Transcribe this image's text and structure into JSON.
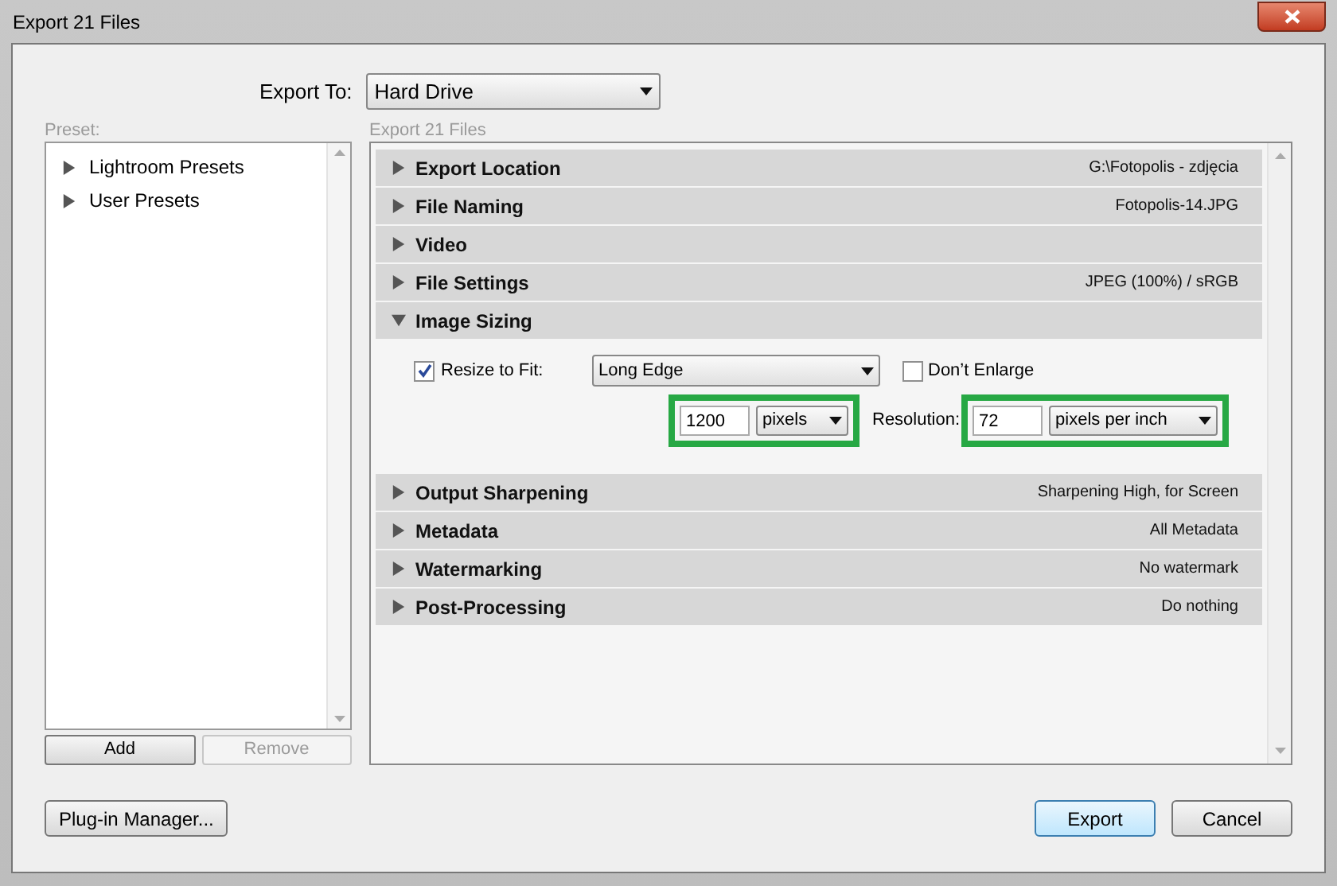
{
  "window": {
    "title": "Export 21 Files"
  },
  "export_to": {
    "label": "Export To:",
    "value": "Hard Drive"
  },
  "preset": {
    "label": "Preset:",
    "items": [
      {
        "label": "Lightroom Presets",
        "expanded": false
      },
      {
        "label": "User Presets",
        "expanded": false
      }
    ],
    "buttons": [
      {
        "label": "Add",
        "disabled": false
      },
      {
        "label": "Remove",
        "disabled": true
      }
    ]
  },
  "panel_title": "Export 21 Files",
  "sections": [
    {
      "title": "Export Location",
      "summary": "G:\\Fotopolis - zdjęcia",
      "expanded": false
    },
    {
      "title": "File Naming",
      "summary": "Fotopolis-14.JPG",
      "expanded": false
    },
    {
      "title": "Video",
      "expanded": false
    },
    {
      "title": "File Settings",
      "summary": "JPEG (100%) / sRGB",
      "expanded": false
    },
    {
      "title": "Image Sizing",
      "expanded": true,
      "content": {
        "resize": {
          "label": "Resize to Fit:",
          "checked": true
        },
        "fit": "Long Edge",
        "dont_enlarge": {
          "label": "Don’t Enlarge",
          "checked": false
        },
        "size": "1200",
        "unit": "pixels",
        "resolution_label": "Resolution:",
        "resolution": "72",
        "resolution_unit": "pixels per inch"
      }
    },
    {
      "title": "Output Sharpening",
      "summary": "Sharpening High, for Screen",
      "expanded": false
    },
    {
      "title": "Metadata",
      "summary": "All Metadata",
      "expanded": false
    },
    {
      "title": "Watermarking",
      "summary": "No watermark",
      "expanded": false
    },
    {
      "title": "Post-Processing",
      "summary": "Do nothing",
      "expanded": false
    }
  ],
  "footer": {
    "left": "Plug-in Manager...",
    "buttons": [
      {
        "label": "Export",
        "default": true
      },
      {
        "label": "Cancel",
        "default": false
      }
    ]
  }
}
